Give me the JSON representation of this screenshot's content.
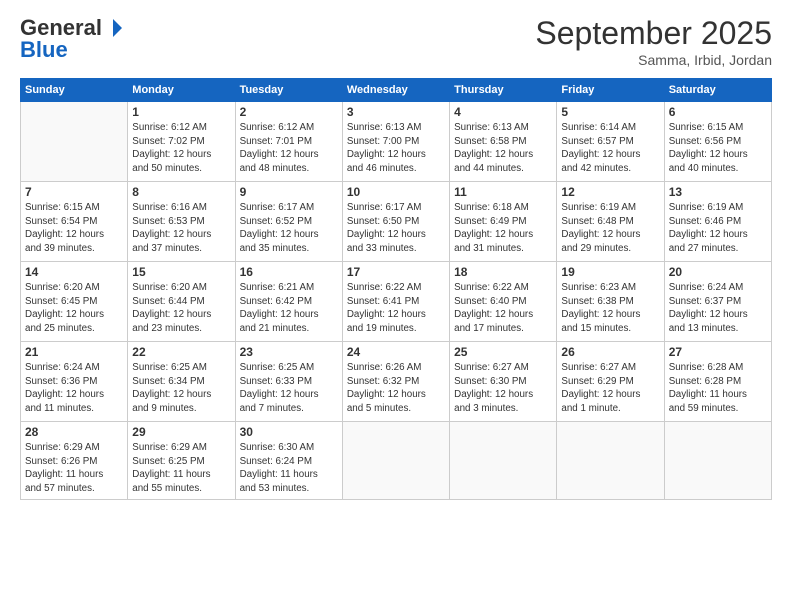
{
  "logo": {
    "general": "General",
    "blue": "Blue"
  },
  "header": {
    "month": "September 2025",
    "location": "Samma, Irbid, Jordan"
  },
  "weekdays": [
    "Sunday",
    "Monday",
    "Tuesday",
    "Wednesday",
    "Thursday",
    "Friday",
    "Saturday"
  ],
  "weeks": [
    [
      {
        "day": "",
        "info": ""
      },
      {
        "day": "1",
        "info": "Sunrise: 6:12 AM\nSunset: 7:02 PM\nDaylight: 12 hours\nand 50 minutes."
      },
      {
        "day": "2",
        "info": "Sunrise: 6:12 AM\nSunset: 7:01 PM\nDaylight: 12 hours\nand 48 minutes."
      },
      {
        "day": "3",
        "info": "Sunrise: 6:13 AM\nSunset: 7:00 PM\nDaylight: 12 hours\nand 46 minutes."
      },
      {
        "day": "4",
        "info": "Sunrise: 6:13 AM\nSunset: 6:58 PM\nDaylight: 12 hours\nand 44 minutes."
      },
      {
        "day": "5",
        "info": "Sunrise: 6:14 AM\nSunset: 6:57 PM\nDaylight: 12 hours\nand 42 minutes."
      },
      {
        "day": "6",
        "info": "Sunrise: 6:15 AM\nSunset: 6:56 PM\nDaylight: 12 hours\nand 40 minutes."
      }
    ],
    [
      {
        "day": "7",
        "info": "Sunrise: 6:15 AM\nSunset: 6:54 PM\nDaylight: 12 hours\nand 39 minutes."
      },
      {
        "day": "8",
        "info": "Sunrise: 6:16 AM\nSunset: 6:53 PM\nDaylight: 12 hours\nand 37 minutes."
      },
      {
        "day": "9",
        "info": "Sunrise: 6:17 AM\nSunset: 6:52 PM\nDaylight: 12 hours\nand 35 minutes."
      },
      {
        "day": "10",
        "info": "Sunrise: 6:17 AM\nSunset: 6:50 PM\nDaylight: 12 hours\nand 33 minutes."
      },
      {
        "day": "11",
        "info": "Sunrise: 6:18 AM\nSunset: 6:49 PM\nDaylight: 12 hours\nand 31 minutes."
      },
      {
        "day": "12",
        "info": "Sunrise: 6:19 AM\nSunset: 6:48 PM\nDaylight: 12 hours\nand 29 minutes."
      },
      {
        "day": "13",
        "info": "Sunrise: 6:19 AM\nSunset: 6:46 PM\nDaylight: 12 hours\nand 27 minutes."
      }
    ],
    [
      {
        "day": "14",
        "info": "Sunrise: 6:20 AM\nSunset: 6:45 PM\nDaylight: 12 hours\nand 25 minutes."
      },
      {
        "day": "15",
        "info": "Sunrise: 6:20 AM\nSunset: 6:44 PM\nDaylight: 12 hours\nand 23 minutes."
      },
      {
        "day": "16",
        "info": "Sunrise: 6:21 AM\nSunset: 6:42 PM\nDaylight: 12 hours\nand 21 minutes."
      },
      {
        "day": "17",
        "info": "Sunrise: 6:22 AM\nSunset: 6:41 PM\nDaylight: 12 hours\nand 19 minutes."
      },
      {
        "day": "18",
        "info": "Sunrise: 6:22 AM\nSunset: 6:40 PM\nDaylight: 12 hours\nand 17 minutes."
      },
      {
        "day": "19",
        "info": "Sunrise: 6:23 AM\nSunset: 6:38 PM\nDaylight: 12 hours\nand 15 minutes."
      },
      {
        "day": "20",
        "info": "Sunrise: 6:24 AM\nSunset: 6:37 PM\nDaylight: 12 hours\nand 13 minutes."
      }
    ],
    [
      {
        "day": "21",
        "info": "Sunrise: 6:24 AM\nSunset: 6:36 PM\nDaylight: 12 hours\nand 11 minutes."
      },
      {
        "day": "22",
        "info": "Sunrise: 6:25 AM\nSunset: 6:34 PM\nDaylight: 12 hours\nand 9 minutes."
      },
      {
        "day": "23",
        "info": "Sunrise: 6:25 AM\nSunset: 6:33 PM\nDaylight: 12 hours\nand 7 minutes."
      },
      {
        "day": "24",
        "info": "Sunrise: 6:26 AM\nSunset: 6:32 PM\nDaylight: 12 hours\nand 5 minutes."
      },
      {
        "day": "25",
        "info": "Sunrise: 6:27 AM\nSunset: 6:30 PM\nDaylight: 12 hours\nand 3 minutes."
      },
      {
        "day": "26",
        "info": "Sunrise: 6:27 AM\nSunset: 6:29 PM\nDaylight: 12 hours\nand 1 minute."
      },
      {
        "day": "27",
        "info": "Sunrise: 6:28 AM\nSunset: 6:28 PM\nDaylight: 11 hours\nand 59 minutes."
      }
    ],
    [
      {
        "day": "28",
        "info": "Sunrise: 6:29 AM\nSunset: 6:26 PM\nDaylight: 11 hours\nand 57 minutes."
      },
      {
        "day": "29",
        "info": "Sunrise: 6:29 AM\nSunset: 6:25 PM\nDaylight: 11 hours\nand 55 minutes."
      },
      {
        "day": "30",
        "info": "Sunrise: 6:30 AM\nSunset: 6:24 PM\nDaylight: 11 hours\nand 53 minutes."
      },
      {
        "day": "",
        "info": ""
      },
      {
        "day": "",
        "info": ""
      },
      {
        "day": "",
        "info": ""
      },
      {
        "day": "",
        "info": ""
      }
    ]
  ]
}
